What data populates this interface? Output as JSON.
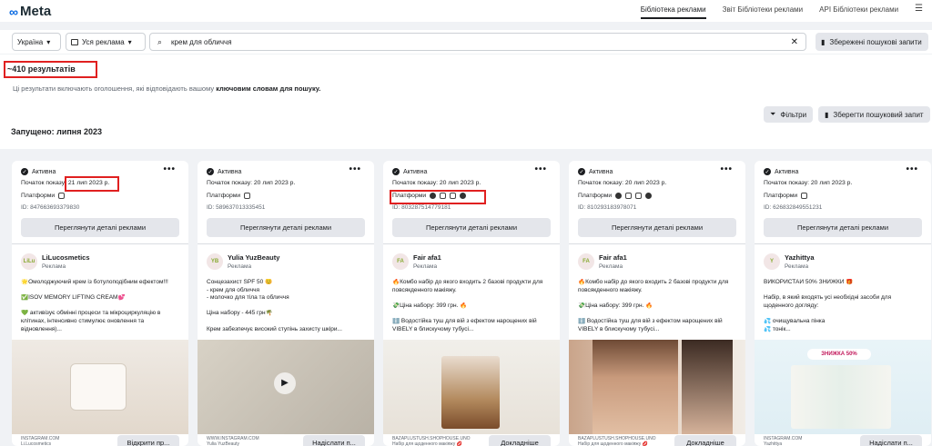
{
  "header": {
    "logo": "Meta",
    "nav": [
      "Бібліотека реклами",
      "Звіт Бібліотеки реклами",
      "API Бібліотеки реклами"
    ],
    "menu_icon": "hamburger-icon"
  },
  "search": {
    "country": "Україна",
    "ad_type": "Уся реклама",
    "query": "крем для обличчя",
    "saved_searches": "Збережені пошукові запити"
  },
  "results": {
    "count": "~410 результатів",
    "description_prefix": "Ці результати включають оголошення, які відповідають вашому ",
    "description_bold": "ключовим словам для пошуку.",
    "filters": "Фільтри",
    "save_search": "Зберегти пошуковий запит",
    "launched": "Запущено: липня 2023"
  },
  "cards": [
    {
      "status": "Активна",
      "start": "Початок показу: ",
      "date": "21 лип 2023 р.",
      "platforms_label": "Платформи",
      "id": "ID: 847663693379830",
      "details": "Переглянути деталі реклами",
      "advertiser": "LiLucosmetics",
      "avatar": "LiLu",
      "ad_label": "Реклама",
      "body": [
        "🌟Омолоджуючий крем із ботулоподібним ефектом!!!",
        "",
        "✅ISOV MEMORY LIFTING CREAM💕",
        "",
        "💚 активізує обмінні процеси та мікроциркуляцію в",
        "клітинах, інтенсивно стимулює оновлення та",
        "відновлення)..."
      ],
      "footer": [
        "INSTAGRAM.COM",
        "Li.Lucosmetics"
      ],
      "cta": "Відкрити пр..."
    },
    {
      "status": "Активна",
      "start": "Початок показу: ",
      "date": "20 лип 2023 р.",
      "platforms_label": "Платформи",
      "id": "ID: 589637013335451",
      "details": "Переглянути деталі реклами",
      "advertiser": "Yulia YuzBeauty",
      "avatar": "YB",
      "ad_label": "Реклама",
      "body": [
        "Сонцезахист SPF 50 😊",
        "- крем для обличчя",
        "- молочко для тіла та обличчя",
        "",
        "Ціна набору - 445 грн🌴",
        "",
        "Крем забезпечує високий ступінь захисту шкіри..."
      ],
      "footer": [
        "WWW.INSTAGRAM.COM",
        "Yulia YuzBeauty"
      ],
      "cta": "Надіслати п..."
    },
    {
      "status": "Активна",
      "start": "Початок показу: ",
      "date": "20 лип 2023 р.",
      "platforms_label": "Платформи",
      "id": "ID: 803287514779181",
      "details": "Переглянути деталі реклами",
      "advertiser": "Fair afa1",
      "avatar": "FA",
      "ad_label": "Реклама",
      "body": [
        "🔥Комбо набір до якого входить 2 базові продукти для",
        "повсякденного макіяжу.",
        "",
        "💸Ціна набору: 399 грн. 🔥",
        "",
        "ℹ️ Водостійка туш для вій з ефектом нарощених вій",
        "VIBELY в блискучому тубусі..."
      ],
      "footer": [
        "BAZAPLUSTUSH.SHOPHOUSE.UNO",
        "Набір для щоденного макіяжу 💋"
      ],
      "cta": "Докладніше"
    },
    {
      "status": "Активна",
      "start": "Початок показу: ",
      "date": "20 лип 2023 р.",
      "platforms_label": "Платформи",
      "id": "ID: 810293183978071",
      "details": "Переглянути деталі реклами",
      "advertiser": "Fair afa1",
      "avatar": "FA",
      "ad_label": "Реклама",
      "body": [
        "🔥Комбо набір до якого входить 2 базові продукти для",
        "повсякденного макіяжу.",
        "",
        "💸Ціна набору: 399 грн. 🔥",
        "",
        "ℹ️ Водостійка туш для вій з ефектом нарощених вій",
        "VIBELY в блискучому тубусі..."
      ],
      "footer": [
        "BAZAPLUSTUSH.SHOPHOUSE.UNO",
        "Набір для щоденного макіяжу 💋"
      ],
      "cta": "Докладніше"
    },
    {
      "status": "Активна",
      "start": "Початок показу: ",
      "date": "20 лип 2023 р.",
      "platforms_label": "Платформи",
      "id": "ID: 626832849551231",
      "details": "Переглянути деталі реклами",
      "advertiser": "Yazhittya",
      "avatar": "Y",
      "ad_label": "Реклама",
      "body": [
        "ВИКОРИСТАЙ 50% ЗНИЖКИ 🎁",
        "",
        "Набір, в який входять усі необхідні засоби для",
        "щоденного догляду:",
        "",
        "💦 очищувальна пінка",
        "💦 тонік..."
      ],
      "footer": [
        "INSTAGRAM.COM",
        "Yazhittya"
      ],
      "cta": "Надіслати п...",
      "img_badge": "ЗНИЖКА 50%"
    }
  ]
}
